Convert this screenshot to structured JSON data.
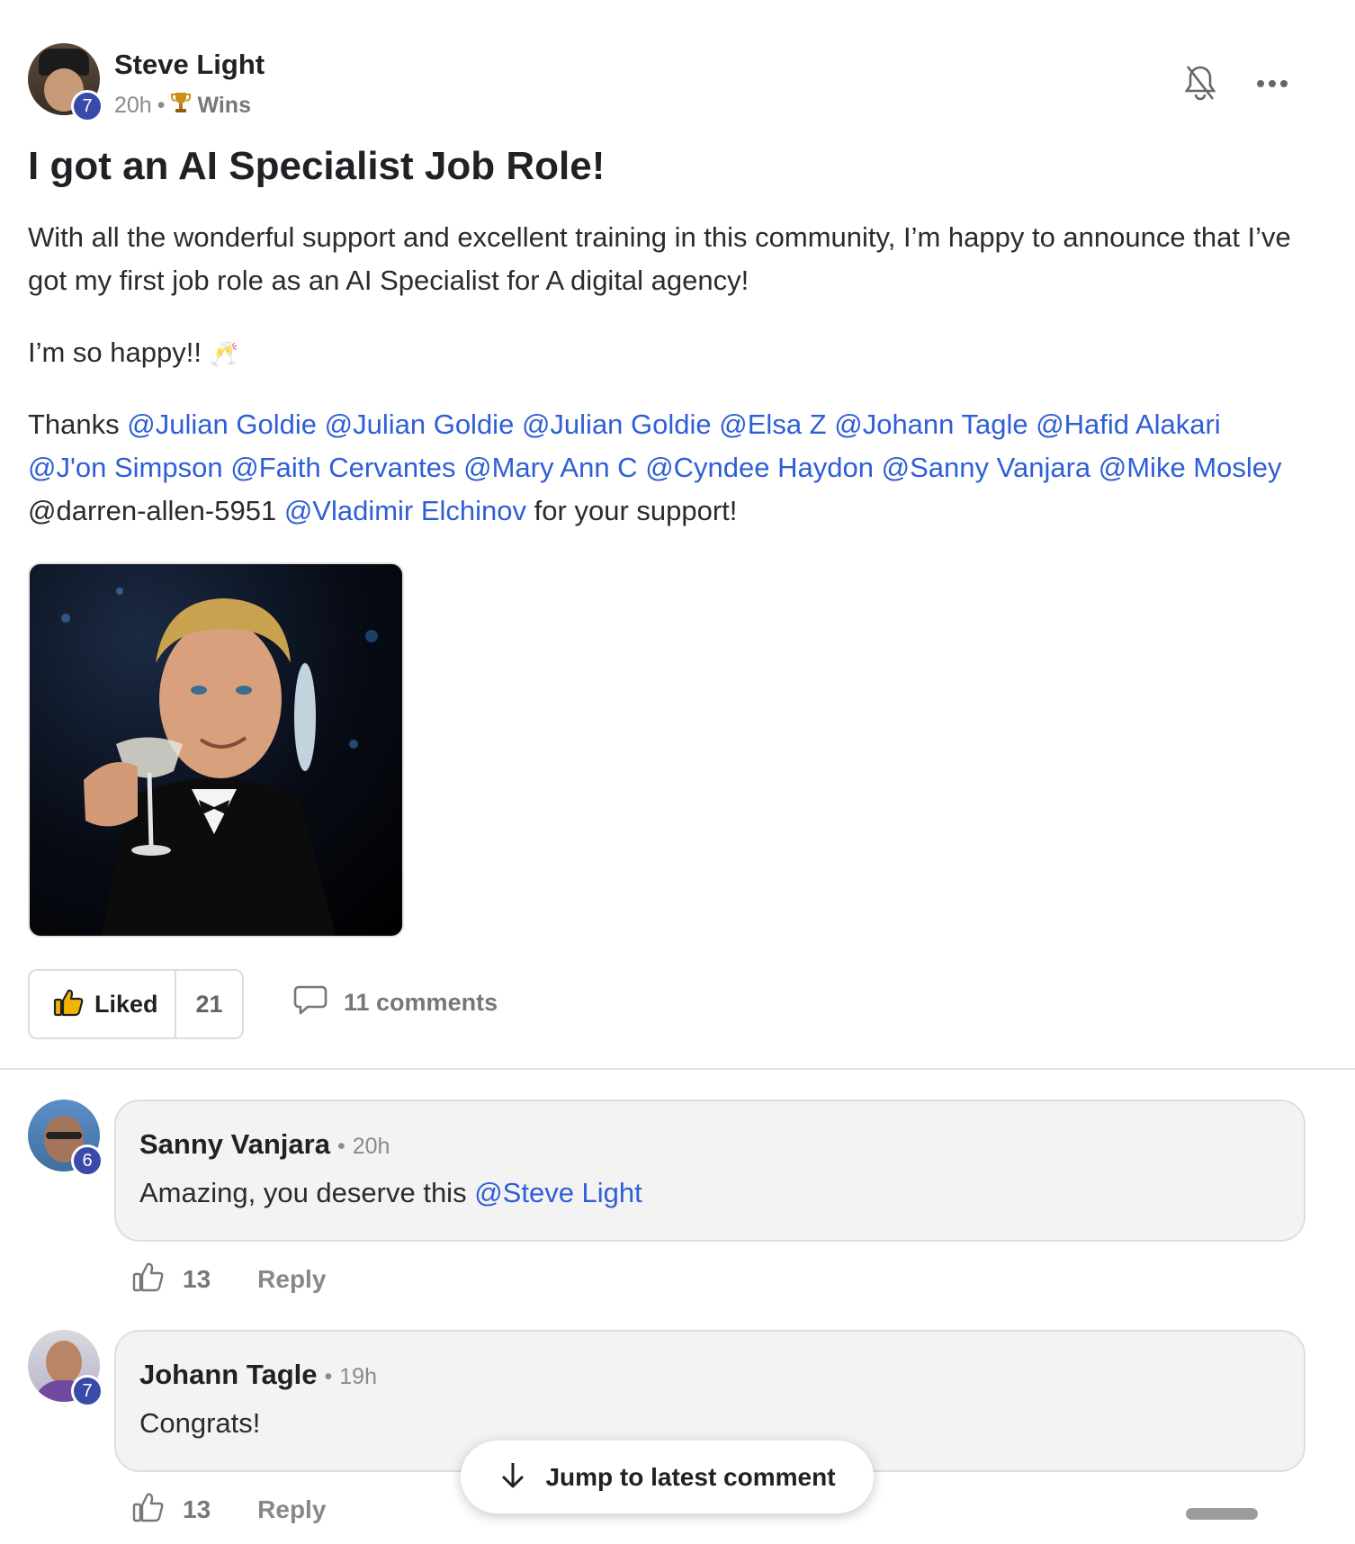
{
  "post": {
    "author": {
      "name": "Steve Light",
      "level": "7",
      "time": "20h",
      "category": "Wins",
      "category_icon": "trophy-icon"
    },
    "header_actions": {
      "bell_icon": "bell-muted-icon",
      "more_icon": "more-horizontal-icon"
    },
    "title": "I got an AI Specialist Job Role!",
    "paragraph1": "With all the wonderful support and excellent training in this community, I’m happy to announce that I’ve got my first job role as an AI Specialist for A digital agency!",
    "paragraph2": "I’m so happy!!",
    "paragraph2_emoji": "🥂",
    "thanks": {
      "prefix": "Thanks",
      "mentions_line1": [
        "@Julian Goldie",
        "@Julian Goldie",
        "@Julian Goldie",
        "@Elsa Z",
        "@Johann Tagle",
        "@Hafid Alakari"
      ],
      "mentions_line2": [
        "@J'on Simpson",
        "@Faith Cervantes",
        "@Mary Ann C",
        "@Cyndee Haydon",
        "@Sanny Vanjara",
        "@Mike Mosley"
      ],
      "plain_handle": "@darren-allen-5951",
      "last_mention": "@Vladimir Elchinov",
      "suffix": "for your support!"
    },
    "image_alt": "toast gif",
    "reactions": {
      "liked_label": "Liked",
      "like_count": "21",
      "comments_label": "11 comments"
    }
  },
  "comments": [
    {
      "name": "Sanny Vanjara",
      "level": "6",
      "time": "20h",
      "text": "Amazing, you deserve this",
      "mention": "@Steve Light",
      "likes": "13",
      "reply_label": "Reply"
    },
    {
      "name": "Johann Tagle",
      "level": "7",
      "time": "19h",
      "text": "Congrats!",
      "mention": "",
      "likes": "13",
      "reply_label": "Reply"
    }
  ],
  "jump_button": {
    "label": "Jump to latest comment",
    "icon": "arrow-down-icon"
  },
  "colors": {
    "mention": "#2f5fd6",
    "level_badge": "#3a4aa8",
    "like_accent": "#f2b400"
  }
}
